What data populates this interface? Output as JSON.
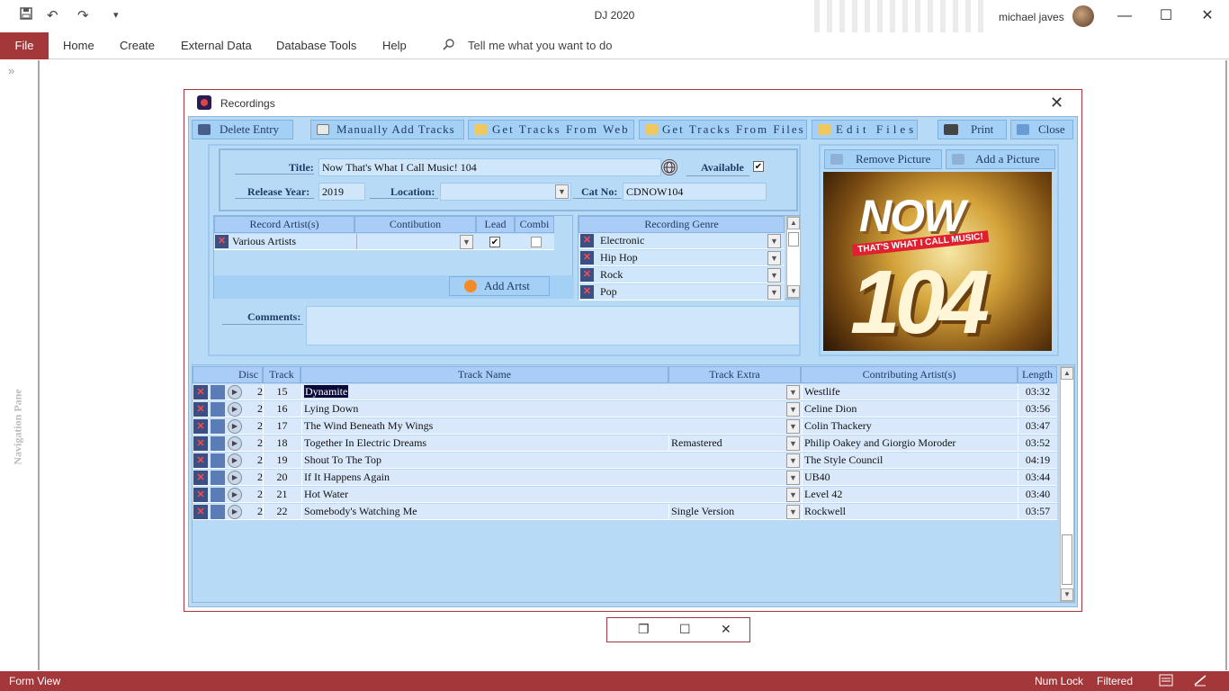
{
  "app": {
    "title": "DJ 2020",
    "user": "michael javes",
    "undo_icon": "↶",
    "redo_icon": "↷",
    "qa_more": "▾",
    "minimize": "—",
    "maximize": "☐",
    "close": "✕"
  },
  "ribbon": {
    "file": "File",
    "tabs": [
      "Home",
      "Create",
      "External Data",
      "Database Tools",
      "Help"
    ],
    "tell_me": "Tell me what you want to do"
  },
  "nav": {
    "label": "Navigation Pane",
    "chev": "»"
  },
  "status": {
    "view": "Form View",
    "numlock": "Num Lock",
    "filtered": "Filtered"
  },
  "form": {
    "title": "Recordings",
    "close": "✕",
    "toolbar": {
      "delete": "Delete Entry",
      "manual": "Manually Add Tracks",
      "web": "Get Tracks From Web",
      "files": "Get Tracks From Files",
      "edit": "Edit Files",
      "print": "Print",
      "close": "Close"
    },
    "title_label": "Title:",
    "title_value": "Now That's What I Call Music! 104",
    "available_label": "Available",
    "available_checked": "✔",
    "year_label": "Release Year:",
    "year_value": "2019",
    "location_label": "Location:",
    "location_value": "",
    "catno_label": "Cat No:",
    "catno_value": "CDNOW104",
    "artists_header": {
      "artist": "Record Artist(s)",
      "contribution": "Contibution",
      "lead": "Lead",
      "combi": "Combi"
    },
    "artists": [
      {
        "name": "Various Artists",
        "contribution": "",
        "lead": "✔",
        "combi": ""
      }
    ],
    "add_artist": "Add Artst",
    "genre_header": "Recording Genre",
    "genres": [
      "Electronic",
      "Hip Hop",
      "Rock",
      "Pop"
    ],
    "comments_label": "Comments:",
    "comments_value": "",
    "remove_picture": "Remove Picture",
    "add_picture": "Add a Picture",
    "cover": {
      "brand": "NOW",
      "tagline": "THAT'S WHAT I CALL MUSIC!",
      "number": "104"
    }
  },
  "tracks": {
    "headers": {
      "disc": "Disc",
      "track": "Track",
      "name": "Track Name",
      "extra": "Track Extra",
      "artist": "Contributing Artist(s)",
      "length": "Length"
    },
    "rows": [
      {
        "disc": "2",
        "track": "15",
        "name": "Dynamite",
        "extra": "",
        "artist": "Westlife",
        "length": "03:32"
      },
      {
        "disc": "2",
        "track": "16",
        "name": "Lying Down",
        "extra": "",
        "artist": "Celine Dion",
        "length": "03:56"
      },
      {
        "disc": "2",
        "track": "17",
        "name": "The Wind Beneath My Wings",
        "extra": "",
        "artist": "Colin Thackery",
        "length": "03:47"
      },
      {
        "disc": "2",
        "track": "18",
        "name": "Together In Electric Dreams",
        "extra": "Remastered",
        "artist": "Philip Oakey and Giorgio Moroder",
        "length": "03:52"
      },
      {
        "disc": "2",
        "track": "19",
        "name": "Shout To The Top",
        "extra": "",
        "artist": "The Style Council",
        "length": "04:19"
      },
      {
        "disc": "2",
        "track": "20",
        "name": "If It Happens Again",
        "extra": "",
        "artist": "UB40",
        "length": "03:44"
      },
      {
        "disc": "2",
        "track": "21",
        "name": "Hot Water",
        "extra": "",
        "artist": "Level 42",
        "length": "03:40"
      },
      {
        "disc": "2",
        "track": "22",
        "name": "Somebody's Watching Me",
        "extra": "Single Version",
        "artist": "Rockwell",
        "length": "03:57"
      }
    ]
  },
  "colors": {
    "accent": "#a4373a",
    "form_bg": "#b7dbf7",
    "button": "#a5d0f6",
    "row": "#d9e9fb"
  }
}
